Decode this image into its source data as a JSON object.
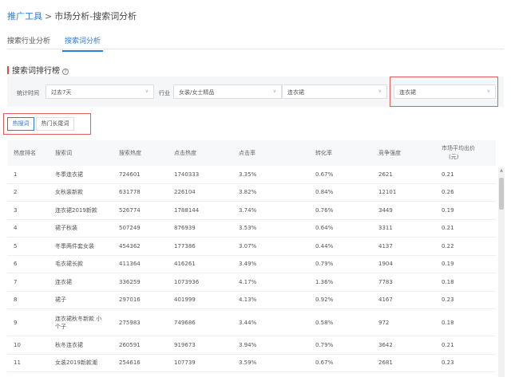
{
  "breadcrumb": {
    "root": "推广工具",
    "separator": ">",
    "current": "市场分析-搜索词分析"
  },
  "top_tabs": [
    {
      "label": "搜索行业分析",
      "active": false
    },
    {
      "label": "搜索词分析",
      "active": true
    }
  ],
  "section": {
    "title": "搜索词排行榜"
  },
  "filters": {
    "time_label": "统计时间",
    "time_value": "过去7天",
    "industry_label": "行业",
    "industry_value": "女装/女士精品",
    "category_value": "连衣裙",
    "keyword_value": "连衣裙"
  },
  "sub_tabs": [
    {
      "label": "热搜词",
      "active": true
    },
    {
      "label": "热门长尾词",
      "active": false
    }
  ],
  "table": {
    "headers": [
      "热度排名",
      "搜索词",
      "搜索热度",
      "点击热度",
      "点击率",
      "转化率",
      "竞争强度",
      "市场平均出价",
      "(元)"
    ],
    "rows": [
      [
        "1",
        "冬季连衣裙",
        "724601",
        "1740333",
        "3.35%",
        "0.67%",
        "2621",
        "0.21"
      ],
      [
        "2",
        "女秋装新款",
        "631778",
        "226104",
        "3.82%",
        "0.84%",
        "12101",
        "0.26"
      ],
      [
        "3",
        "连衣裙2019新款",
        "526774",
        "1788144",
        "3.74%",
        "0.76%",
        "3449",
        "0.19"
      ],
      [
        "4",
        "裙子秋装",
        "507249",
        "876939",
        "3.53%",
        "0.64%",
        "3311",
        "0.21"
      ],
      [
        "5",
        "冬季两件套女装",
        "454362",
        "177386",
        "3.07%",
        "0.44%",
        "4137",
        "0.22"
      ],
      [
        "6",
        "毛衣裙长款",
        "411364",
        "416261",
        "3.49%",
        "0.79%",
        "1904",
        "0.19"
      ],
      [
        "7",
        "连衣裙",
        "336259",
        "1073936",
        "4.17%",
        "1.36%",
        "7783",
        "0.18"
      ],
      [
        "8",
        "裙子",
        "297016",
        "401999",
        "4.13%",
        "0.92%",
        "4167",
        "0.23"
      ],
      [
        "9",
        "连衣裙秋冬新款 小个子",
        "275983",
        "749686",
        "3.44%",
        "0.58%",
        "972",
        "0.18"
      ],
      [
        "10",
        "秋冬连衣裙",
        "260591",
        "919673",
        "3.94%",
        "0.79%",
        "3642",
        "0.21"
      ],
      [
        "11",
        "女装2019新款潮",
        "254616",
        "107739",
        "3.59%",
        "0.67%",
        "2681",
        "0.23"
      ]
    ]
  },
  "colors": {
    "accent": "#2b7be3",
    "highlight": "#e45b5b"
  },
  "icons": {
    "help": "question-circle-icon",
    "dropdown": "chevron-down-icon",
    "scroll_up": "triangle-up-icon"
  }
}
